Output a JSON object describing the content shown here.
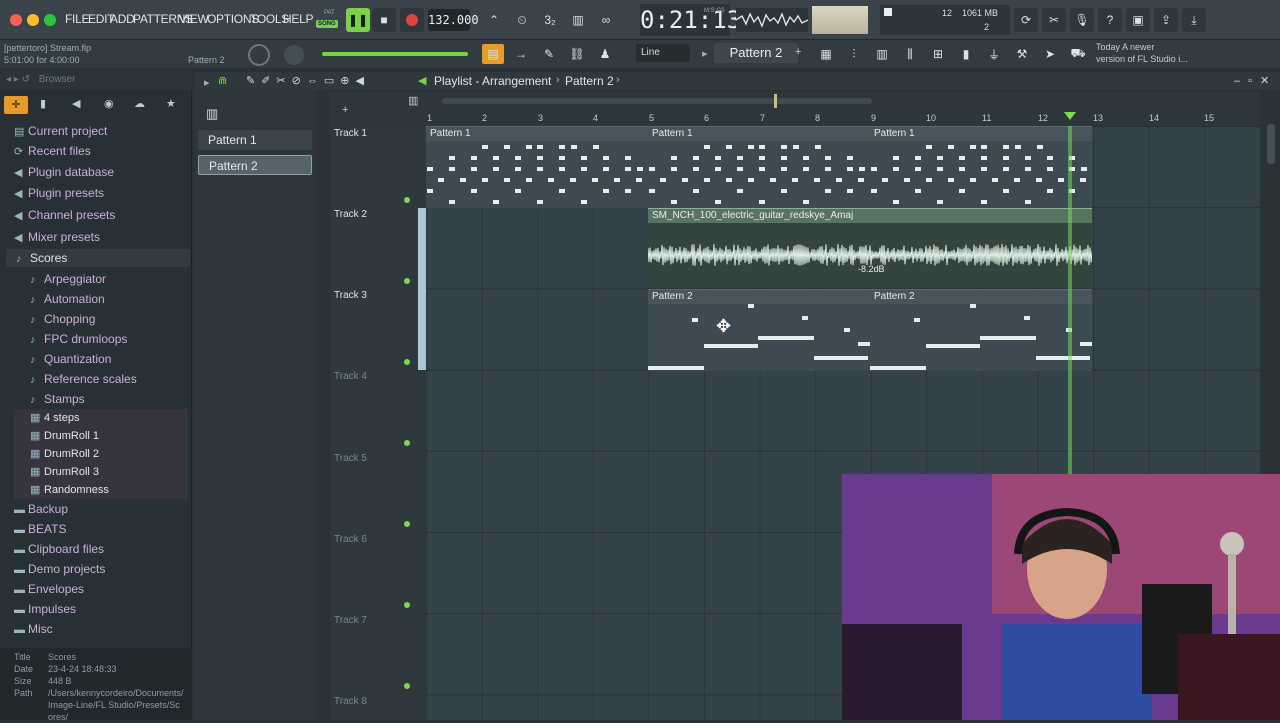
{
  "menu": {
    "items": [
      "FILE",
      "EDIT",
      "ADD",
      "PATTERNS",
      "VIEW",
      "OPTIONS",
      "TOOLS",
      "HELP"
    ]
  },
  "transport": {
    "mode_pat": "PAT",
    "mode_song": "SONG",
    "tempo": "132.000",
    "time": "0:21:13",
    "time_label": "M:S:CS"
  },
  "meters": {
    "cpu_value": "12",
    "memory": "1061 MB",
    "polyphony": "2"
  },
  "hint": {
    "line1": "[pettertoro] Stream.flp",
    "line2": "5:01:00 for 4:00:00",
    "pattern_label": "Pattern 2"
  },
  "toolbar2": {
    "snap": "Line",
    "pattern": "Pattern 2"
  },
  "news": {
    "line1": "Today  A newer",
    "line2": "version of FL Studio i..."
  },
  "browser": {
    "title": "Browser",
    "items": [
      {
        "label": "Current project",
        "icon": "▤"
      },
      {
        "label": "Recent files",
        "icon": "⟳"
      },
      {
        "label": "Plugin database",
        "icon": "◀"
      },
      {
        "label": "Plugin presets",
        "icon": "◀"
      },
      {
        "label": "Channel presets",
        "icon": "◀"
      },
      {
        "label": "Mixer presets",
        "icon": "◀"
      },
      {
        "label": "Scores",
        "icon": "♪"
      }
    ],
    "score_items": [
      "Arpeggiator",
      "Automation",
      "Chopping",
      "FPC drumloops",
      "Quantization",
      "Reference scales",
      "Stamps"
    ],
    "files": [
      "4 steps",
      "DrumRoll 1",
      "DrumRoll 2",
      "DrumRoll 3",
      "Randomness"
    ],
    "more": [
      "Backup",
      "BEATS",
      "Clipboard files",
      "Demo projects",
      "Envelopes",
      "Impulses",
      "Misc"
    ],
    "footer": {
      "title_k": "Title",
      "title_v": "Scores",
      "date_k": "Date",
      "date_v": "23-4-24 18:48:33",
      "size_k": "Size",
      "size_v": "448 B",
      "path_k": "Path",
      "path_v": "/Users/kennycordeiro/Documents/Image-Line/FL Studio/Presets/Scores/"
    }
  },
  "picker": {
    "patterns": [
      "Pattern 1",
      "Pattern 2"
    ]
  },
  "playlist": {
    "title": "Playlist - Arrangement",
    "crumb": "Pattern 2",
    "ruler": [
      "1",
      "2",
      "3",
      "4",
      "5",
      "6",
      "7",
      "8",
      "9",
      "10",
      "11",
      "12",
      "13",
      "14",
      "15"
    ],
    "tracks": [
      "Track 1",
      "Track 2",
      "Track 3",
      "Track 4",
      "Track 5",
      "Track 6",
      "Track 7",
      "Track 8"
    ],
    "clips": {
      "p1a": "Pattern 1",
      "p1b": "Pattern 1",
      "p1c": "Pattern 1",
      "audio": "SM_NCH_100_electric_guitar_redskye_Amaj",
      "audio_gain": "-8.2dB",
      "p2a": "Pattern 2",
      "p2b": "Pattern 2"
    }
  },
  "colors": {
    "accent": "#7bd04a",
    "audio_clip": "#58735f",
    "pattern_clip": "#3e4a51",
    "record": "#e0453c"
  }
}
